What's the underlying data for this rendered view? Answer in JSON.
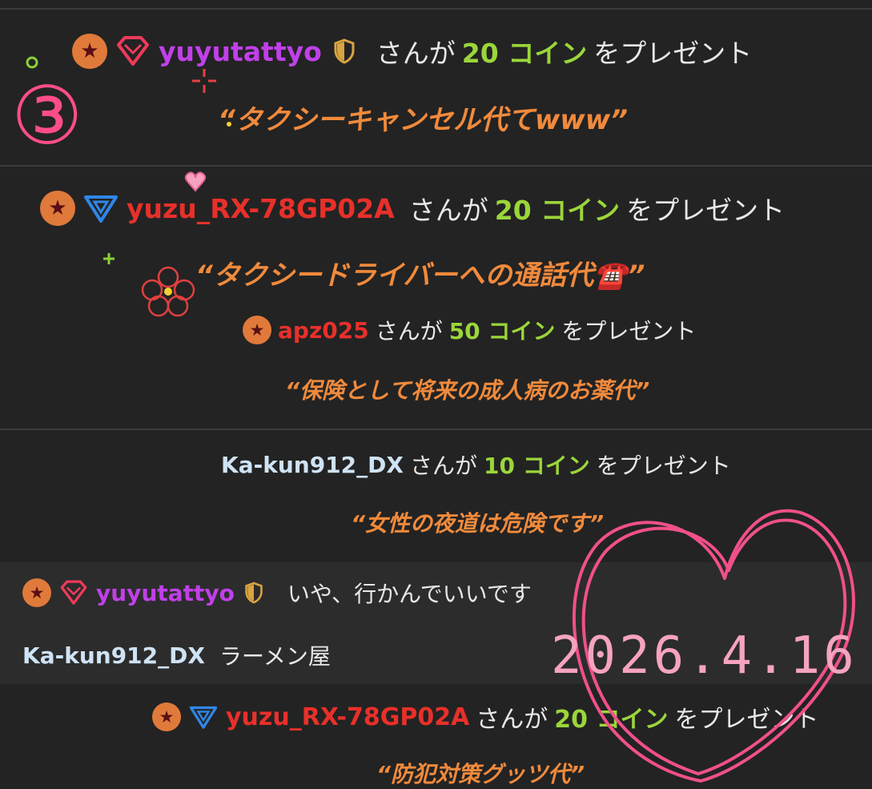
{
  "annotation_number": "③",
  "date_stamp": "2026.4.16",
  "gifts": [
    {
      "user": "yuyutattyo",
      "verb": "さんが",
      "amount": "20 コイン",
      "action": "をプレゼント",
      "message": "“タクシーキャンセル代てwww”"
    },
    {
      "user": "yuzu_RX-78GP02A",
      "verb": "さんが",
      "amount": "20 コイン",
      "action": "をプレゼント",
      "message": "“タクシードライバーへの通話代☎️”"
    },
    {
      "user": "apz025",
      "verb": "さんが",
      "amount": "50 コイン",
      "action": "をプレゼント",
      "message": "“保険として将来の成人病のお薬代”"
    },
    {
      "user": "Ka-kun912_DX",
      "verb": "さんが",
      "amount": "10 コイン",
      "action": "をプレゼント",
      "message": "“女性の夜道は危険です”"
    },
    {
      "user": "yuzu_RX-78GP02A",
      "verb": "さんが",
      "amount": "20 コイン",
      "action": "をプレゼント",
      "message": "“防犯対策グッツ代”"
    }
  ],
  "chat": [
    {
      "user": "yuyutattyo",
      "text": "いや、行かんでいいです"
    },
    {
      "user": "Ka-kun912_DX",
      "text": "ラーメン屋"
    }
  ],
  "colors": {
    "background": "#232323",
    "coin_green": "#9bd63a",
    "message_orange": "#f08a3c",
    "user_purple": "#c040e8",
    "user_red": "#e8302a",
    "user_lightblue": "#cfe3f5",
    "heart_pink": "#f0508a"
  },
  "icons": [
    "star-badge-icon",
    "gem-badge-icon",
    "shield-icon",
    "triangle-badge-icon"
  ]
}
